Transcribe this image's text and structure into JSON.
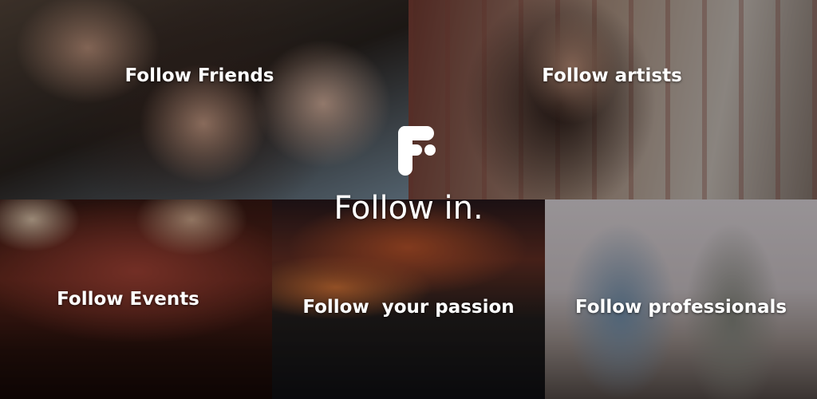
{
  "brand": {
    "title": "Follow in.",
    "logo_icon": "follow-in-logo-icon",
    "color": "#ffffff"
  },
  "tiles": [
    {
      "caption": "Follow Friends",
      "photo": "three friends lying down with sunglasses"
    },
    {
      "caption": "Follow artists",
      "photo": "woman playing guitar in guitar store"
    },
    {
      "caption": "Follow Events",
      "photo": "concert crowd with stage lights"
    },
    {
      "caption": "Follow  your passion",
      "photo": "crowd at night festival"
    },
    {
      "caption": "Follow professionals",
      "photo": "people meeting in office"
    }
  ]
}
